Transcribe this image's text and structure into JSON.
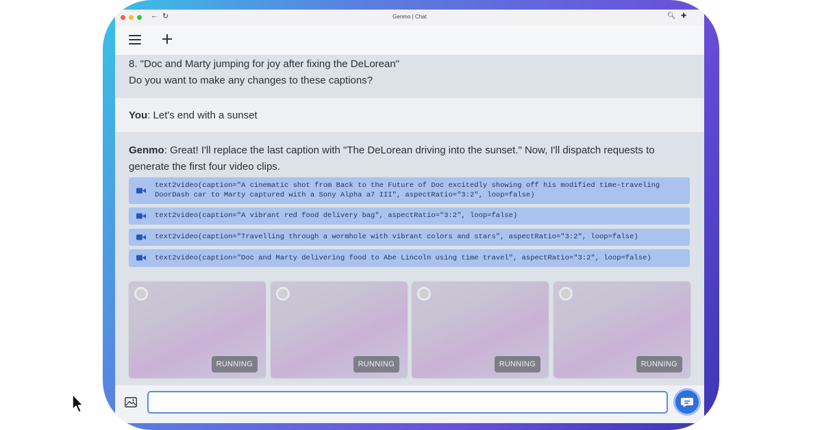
{
  "browser": {
    "tab_title": "Genmo | Chat",
    "back_glyph": "←",
    "reload_glyph": "↻",
    "zoom_glyph": "🔍︎",
    "extensions_glyph": "✚"
  },
  "chat": {
    "prev_message": {
      "line1": "8. \"Doc and Marty jumping for joy after fixing the DeLorean\"",
      "line2": "Do you want to make any changes to these captions?"
    },
    "user_message": {
      "speaker": "You",
      "text": ": Let's end with a sunset"
    },
    "assistant_message": {
      "speaker": "Genmo",
      "text": ": Great! I'll replace the last caption with \"The DeLorean driving into the sunset.\" Now, I'll dispatch requests to generate the first four video clips."
    },
    "tool_calls": [
      {
        "code": "text2video(caption=\"A cinematic shot from Back to the Future of Doc excitedly showing off his modified time-traveling DoorDash car to Marty captured with a Sony Alpha a7 III\", aspectRatio=\"3:2\", loop=false)",
        "icon": "video-camera-icon"
      },
      {
        "code": "text2video(caption=\"A vibrant red food delivery bag\", aspectRatio=\"3:2\", loop=false)",
        "icon": "video-camera-icon"
      },
      {
        "code": "text2video(caption=\"Travelling through a wormhole with vibrant colors and stars\", aspectRatio=\"3:2\", loop=false)",
        "icon": "video-camera-icon"
      },
      {
        "code": "text2video(caption=\"Doc and Marty delivering food to Abe Lincoln using time travel\", aspectRatio=\"3:2\", loop=false)",
        "icon": "video-camera-icon"
      }
    ],
    "video_cards": [
      {
        "status": "RUNNING"
      },
      {
        "status": "RUNNING"
      },
      {
        "status": "RUNNING"
      },
      {
        "status": "RUNNING"
      }
    ]
  },
  "input": {
    "value": "",
    "placeholder": ""
  },
  "colors": {
    "accent": "#2f6fe0",
    "tool_bg": "#a9c3ee",
    "status_badge": "#7d7f86"
  }
}
